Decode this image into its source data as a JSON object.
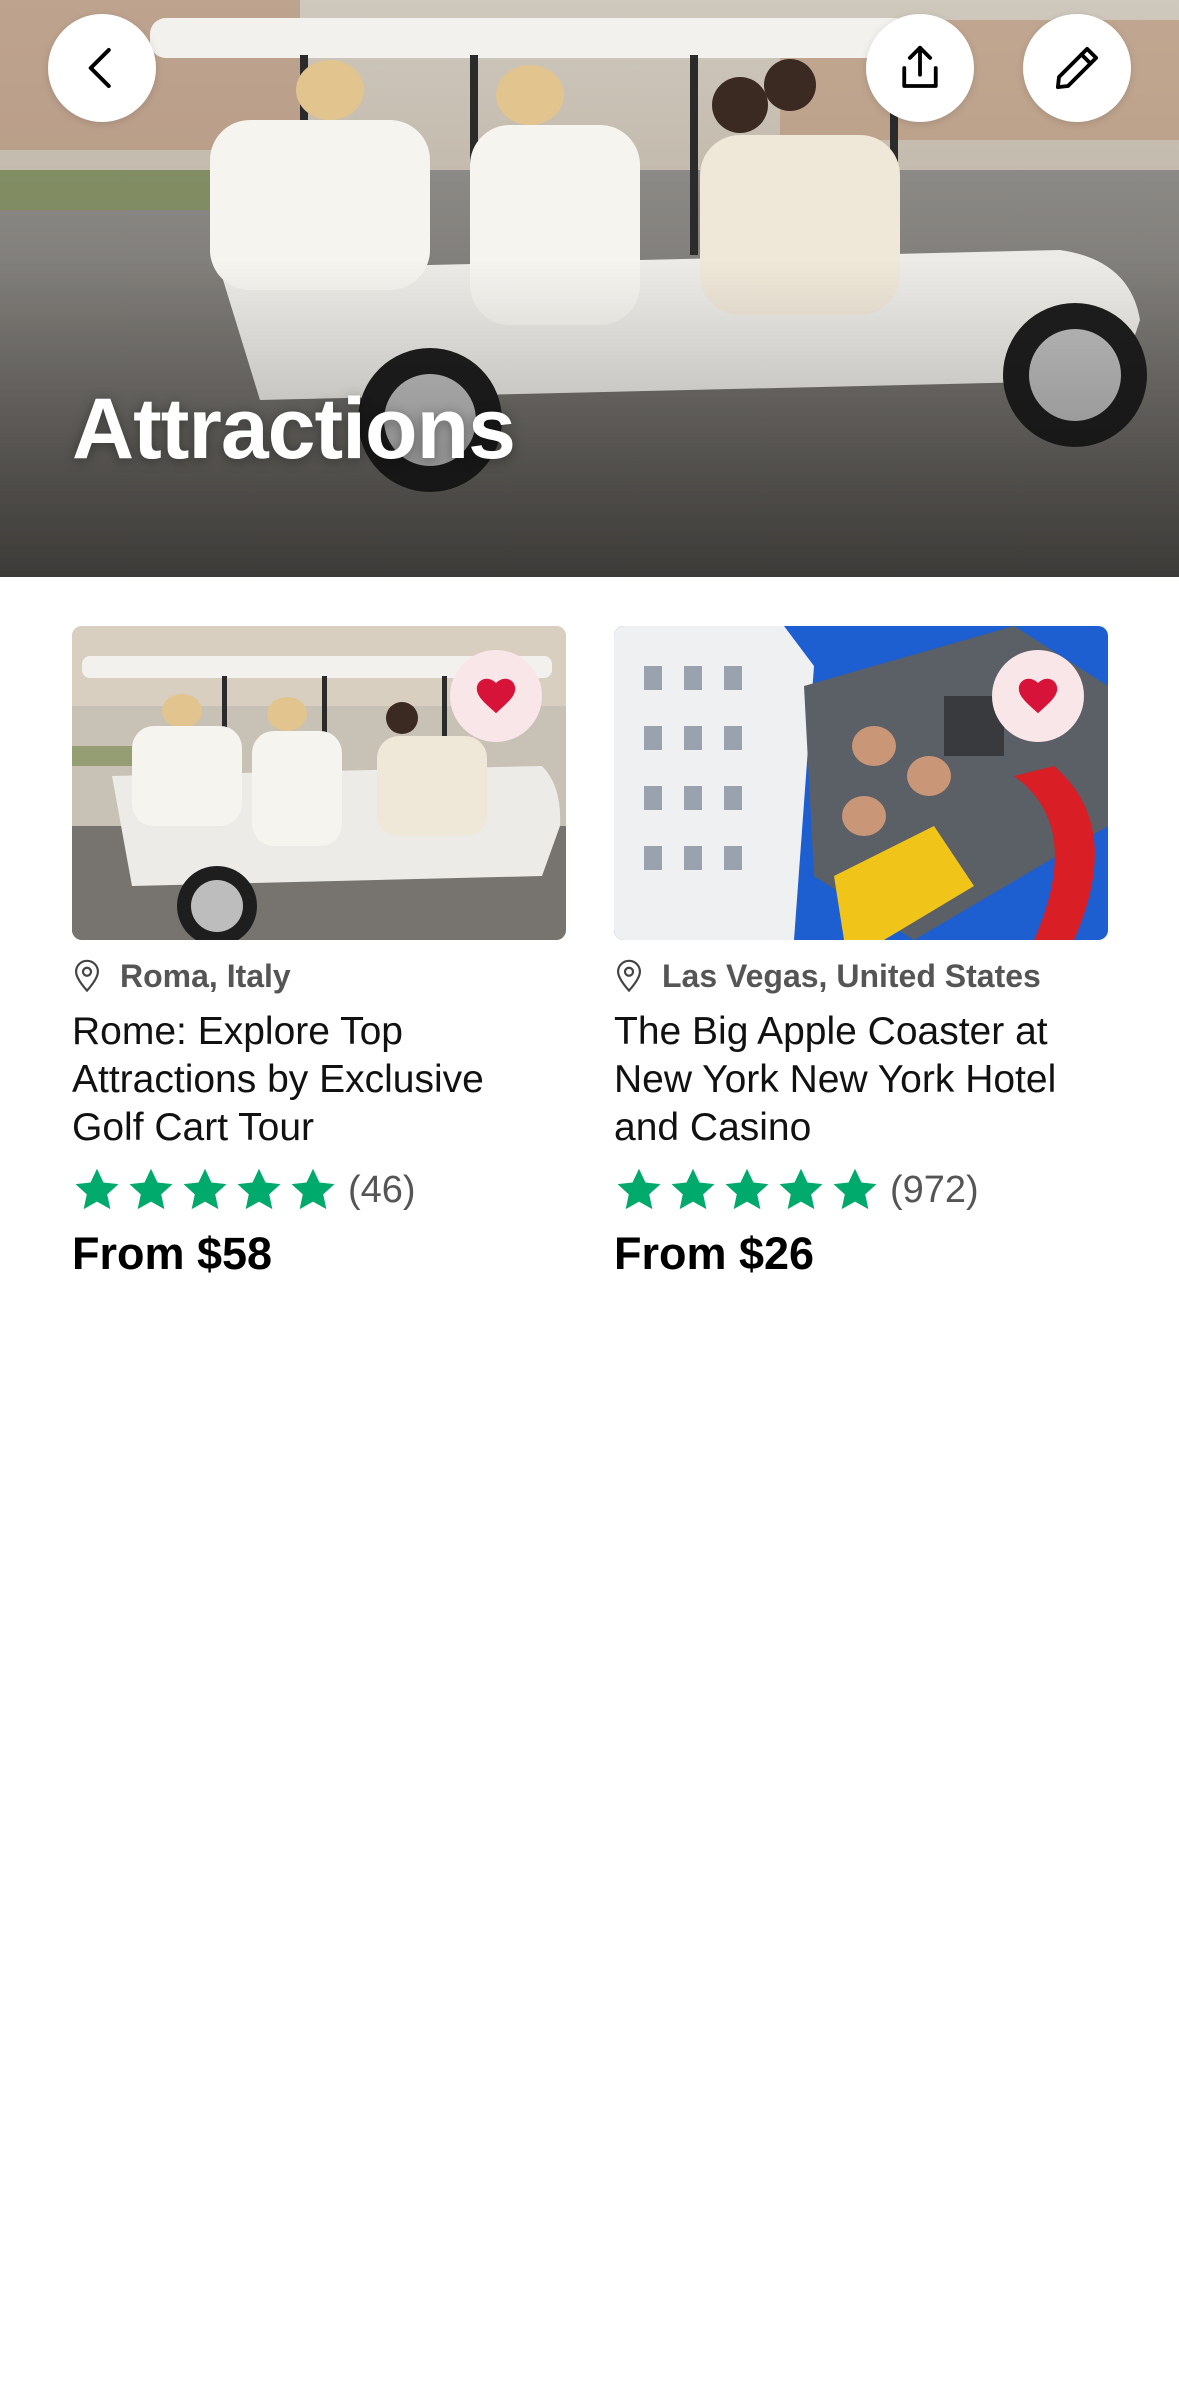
{
  "header": {
    "title": "Attractions",
    "back_icon": "chevron-left-icon",
    "share_icon": "share-icon",
    "edit_icon": "pencil-icon"
  },
  "colors": {
    "star": "#00aa6c",
    "heart": "#d7133a",
    "heart_bg": "#f8e6e9",
    "muted_text": "#555555"
  },
  "cards": [
    {
      "location": "Roma, Italy",
      "title": "Rome: Explore Top Attractions by Exclusive Golf Cart Tour",
      "rating_stars": 5,
      "review_count": "(46)",
      "price": "From $58",
      "favorited": true
    },
    {
      "location": "Las Vegas, United States",
      "title": "The Big Apple Coaster at New York New York Hotel and Casino",
      "rating_stars": 5,
      "review_count": "(972)",
      "price": "From $26",
      "favorited": true
    }
  ]
}
